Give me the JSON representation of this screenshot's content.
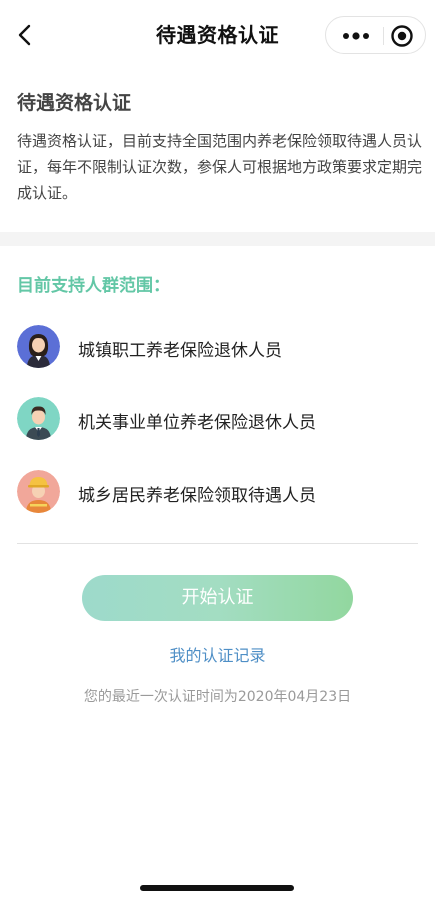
{
  "navbar": {
    "title": "待遇资格认证",
    "back_icon": "chevron-left-icon",
    "more_icon": "more-dots-icon",
    "close_icon": "target-circle-icon"
  },
  "intro": {
    "title": "待遇资格认证",
    "description": "待遇资格认证，目前支持全国范围内养老保险领取待遇人员认证，每年不限制认证次数，参保人可根据地方政策要求定期完成认证。"
  },
  "groups": {
    "title": "目前支持人群范围：",
    "items": [
      {
        "label": "城镇职工养老保险退休人员",
        "avatar": "woman-avatar-icon",
        "color": "#5b6fd6"
      },
      {
        "label": "机关事业单位养老保险退休人员",
        "avatar": "man-avatar-icon",
        "color": "#7fd6c4"
      },
      {
        "label": "城乡居民养老保险领取待遇人员",
        "avatar": "worker-avatar-icon",
        "color": "#f1a79a"
      }
    ]
  },
  "actions": {
    "start_label": "开始认证",
    "record_label": "我的认证记录",
    "last_time_text": "您的最近一次认证时间为2020年04月23日"
  },
  "colors": {
    "accent_green": "#63c7a6",
    "link_blue": "#4f8fc6",
    "button_gradient_start": "#9ddacb",
    "button_gradient_end": "#92d79f"
  }
}
